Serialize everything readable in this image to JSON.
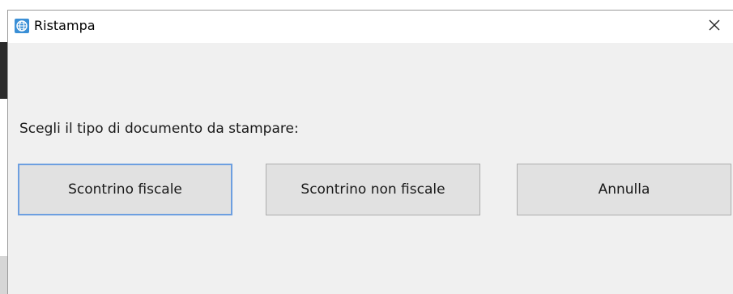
{
  "window": {
    "title": "Ristampa",
    "icon": "app-globe-icon",
    "close_icon": "close-icon"
  },
  "dialog": {
    "prompt": "Scegli il tipo di documento da stampare:",
    "buttons": [
      {
        "label": "Scontrino fiscale",
        "focused": true
      },
      {
        "label": "Scontrino non fiscale",
        "focused": false
      },
      {
        "label": "Annulla",
        "focused": false
      }
    ]
  },
  "colors": {
    "dialog_bg": "#f0f0f0",
    "titlebar_bg": "#ffffff",
    "button_bg": "#e1e1e1",
    "focus_border": "#6d9fe0"
  }
}
